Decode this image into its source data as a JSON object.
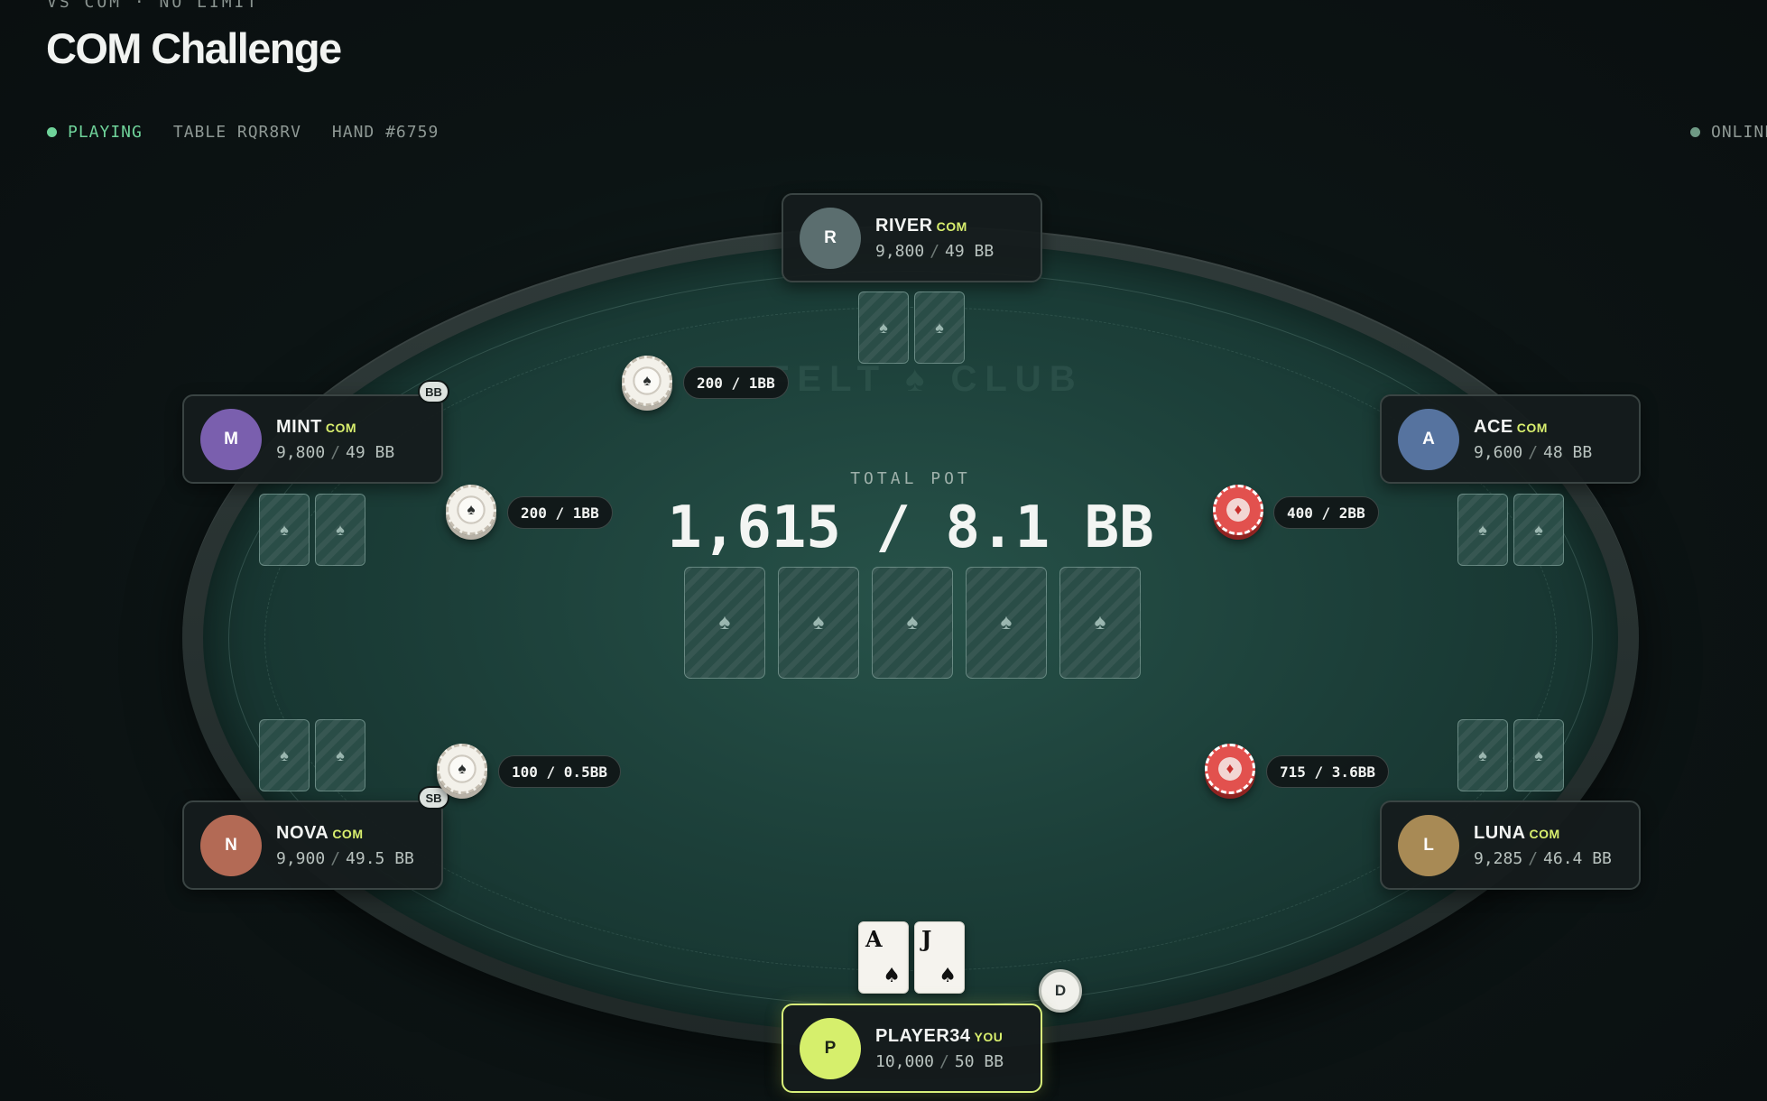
{
  "header": {
    "subtitle": "VS COM · NO LIMIT",
    "title": "COM Challenge"
  },
  "status": {
    "state": "PLAYING",
    "table": "TABLE RQR8RV",
    "hand": "HAND #6759",
    "connection": "ONLINE",
    "state_color": "#6fd39a"
  },
  "table": {
    "watermark": "FELT ♠ CLUB",
    "pot_label": "TOTAL POT",
    "pot_value": "1,615 / 8.1 BB",
    "board_cards": [
      "♠",
      "♠",
      "♠",
      "♠",
      "♠"
    ]
  },
  "players": {
    "river": {
      "initial": "R",
      "name": "RIVER",
      "tag": "COM",
      "chips": "9,800",
      "bb": "49 BB",
      "color": "#5b6e6f"
    },
    "mint": {
      "initial": "M",
      "name": "MINT",
      "tag": "COM",
      "chips": "9,800",
      "bb": "49 BB",
      "color": "#7a5fae",
      "position": "BB"
    },
    "ace": {
      "initial": "A",
      "name": "ACE",
      "tag": "COM",
      "chips": "9,600",
      "bb": "48 BB",
      "color": "#56739f"
    },
    "nova": {
      "initial": "N",
      "name": "NOVA",
      "tag": "COM",
      "chips": "9,900",
      "bb": "49.5 BB",
      "color": "#b36a55",
      "position": "SB"
    },
    "luna": {
      "initial": "L",
      "name": "LUNA",
      "tag": "COM",
      "chips": "9,285",
      "bb": "46.4 BB",
      "color": "#a88a55"
    },
    "you": {
      "initial": "P",
      "name": "PLAYER34",
      "tag": "YOU",
      "chips": "10,000",
      "bb": "50 BB",
      "color": "#d6ef6c",
      "hole_cards": [
        {
          "rank": "A",
          "suit": "♠"
        },
        {
          "rank": "J",
          "suit": "♠"
        }
      ],
      "dealer": "D"
    }
  },
  "bets": {
    "river": "200 / 1BB",
    "mint": "200 / 1BB",
    "ace": "400 / 2BB",
    "nova": "100 / 0.5BB",
    "luna": "715 / 3.6BB"
  },
  "chip_icon": "♠",
  "chip_icon_red": "♦",
  "card_back_icon": "♠",
  "stack_separator": "/"
}
